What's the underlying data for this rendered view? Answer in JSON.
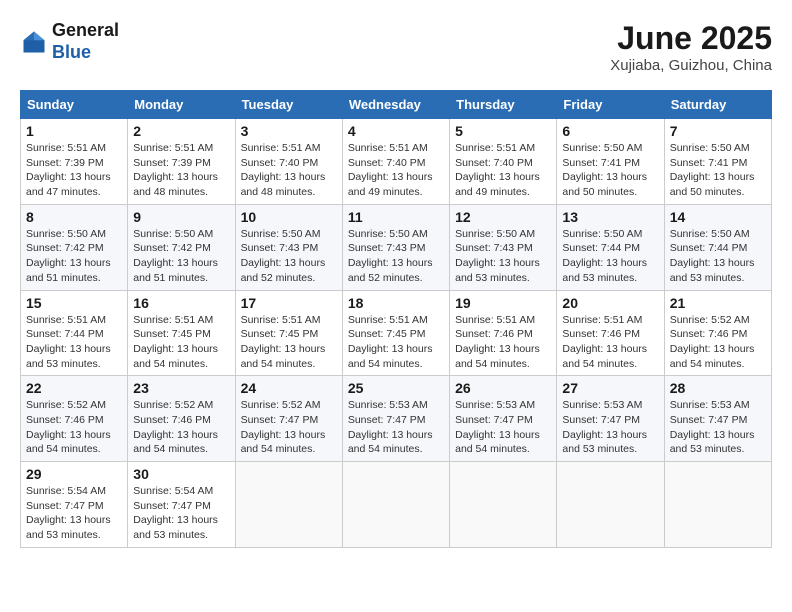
{
  "header": {
    "logo_general": "General",
    "logo_blue": "Blue",
    "title": "June 2025",
    "location": "Xujiaba, Guizhou, China"
  },
  "weekdays": [
    "Sunday",
    "Monday",
    "Tuesday",
    "Wednesday",
    "Thursday",
    "Friday",
    "Saturday"
  ],
  "weeks": [
    [
      {
        "day": "1",
        "sunrise": "5:51 AM",
        "sunset": "7:39 PM",
        "daylight": "13 hours and 47 minutes."
      },
      {
        "day": "2",
        "sunrise": "5:51 AM",
        "sunset": "7:39 PM",
        "daylight": "13 hours and 48 minutes."
      },
      {
        "day": "3",
        "sunrise": "5:51 AM",
        "sunset": "7:40 PM",
        "daylight": "13 hours and 48 minutes."
      },
      {
        "day": "4",
        "sunrise": "5:51 AM",
        "sunset": "7:40 PM",
        "daylight": "13 hours and 49 minutes."
      },
      {
        "day": "5",
        "sunrise": "5:51 AM",
        "sunset": "7:40 PM",
        "daylight": "13 hours and 49 minutes."
      },
      {
        "day": "6",
        "sunrise": "5:50 AM",
        "sunset": "7:41 PM",
        "daylight": "13 hours and 50 minutes."
      },
      {
        "day": "7",
        "sunrise": "5:50 AM",
        "sunset": "7:41 PM",
        "daylight": "13 hours and 50 minutes."
      }
    ],
    [
      {
        "day": "8",
        "sunrise": "5:50 AM",
        "sunset": "7:42 PM",
        "daylight": "13 hours and 51 minutes."
      },
      {
        "day": "9",
        "sunrise": "5:50 AM",
        "sunset": "7:42 PM",
        "daylight": "13 hours and 51 minutes."
      },
      {
        "day": "10",
        "sunrise": "5:50 AM",
        "sunset": "7:43 PM",
        "daylight": "13 hours and 52 minutes."
      },
      {
        "day": "11",
        "sunrise": "5:50 AM",
        "sunset": "7:43 PM",
        "daylight": "13 hours and 52 minutes."
      },
      {
        "day": "12",
        "sunrise": "5:50 AM",
        "sunset": "7:43 PM",
        "daylight": "13 hours and 53 minutes."
      },
      {
        "day": "13",
        "sunrise": "5:50 AM",
        "sunset": "7:44 PM",
        "daylight": "13 hours and 53 minutes."
      },
      {
        "day": "14",
        "sunrise": "5:50 AM",
        "sunset": "7:44 PM",
        "daylight": "13 hours and 53 minutes."
      }
    ],
    [
      {
        "day": "15",
        "sunrise": "5:51 AM",
        "sunset": "7:44 PM",
        "daylight": "13 hours and 53 minutes."
      },
      {
        "day": "16",
        "sunrise": "5:51 AM",
        "sunset": "7:45 PM",
        "daylight": "13 hours and 54 minutes."
      },
      {
        "day": "17",
        "sunrise": "5:51 AM",
        "sunset": "7:45 PM",
        "daylight": "13 hours and 54 minutes."
      },
      {
        "day": "18",
        "sunrise": "5:51 AM",
        "sunset": "7:45 PM",
        "daylight": "13 hours and 54 minutes."
      },
      {
        "day": "19",
        "sunrise": "5:51 AM",
        "sunset": "7:46 PM",
        "daylight": "13 hours and 54 minutes."
      },
      {
        "day": "20",
        "sunrise": "5:51 AM",
        "sunset": "7:46 PM",
        "daylight": "13 hours and 54 minutes."
      },
      {
        "day": "21",
        "sunrise": "5:52 AM",
        "sunset": "7:46 PM",
        "daylight": "13 hours and 54 minutes."
      }
    ],
    [
      {
        "day": "22",
        "sunrise": "5:52 AM",
        "sunset": "7:46 PM",
        "daylight": "13 hours and 54 minutes."
      },
      {
        "day": "23",
        "sunrise": "5:52 AM",
        "sunset": "7:46 PM",
        "daylight": "13 hours and 54 minutes."
      },
      {
        "day": "24",
        "sunrise": "5:52 AM",
        "sunset": "7:47 PM",
        "daylight": "13 hours and 54 minutes."
      },
      {
        "day": "25",
        "sunrise": "5:53 AM",
        "sunset": "7:47 PM",
        "daylight": "13 hours and 54 minutes."
      },
      {
        "day": "26",
        "sunrise": "5:53 AM",
        "sunset": "7:47 PM",
        "daylight": "13 hours and 54 minutes."
      },
      {
        "day": "27",
        "sunrise": "5:53 AM",
        "sunset": "7:47 PM",
        "daylight": "13 hours and 53 minutes."
      },
      {
        "day": "28",
        "sunrise": "5:53 AM",
        "sunset": "7:47 PM",
        "daylight": "13 hours and 53 minutes."
      }
    ],
    [
      {
        "day": "29",
        "sunrise": "5:54 AM",
        "sunset": "7:47 PM",
        "daylight": "13 hours and 53 minutes."
      },
      {
        "day": "30",
        "sunrise": "5:54 AM",
        "sunset": "7:47 PM",
        "daylight": "13 hours and 53 minutes."
      },
      null,
      null,
      null,
      null,
      null
    ]
  ]
}
